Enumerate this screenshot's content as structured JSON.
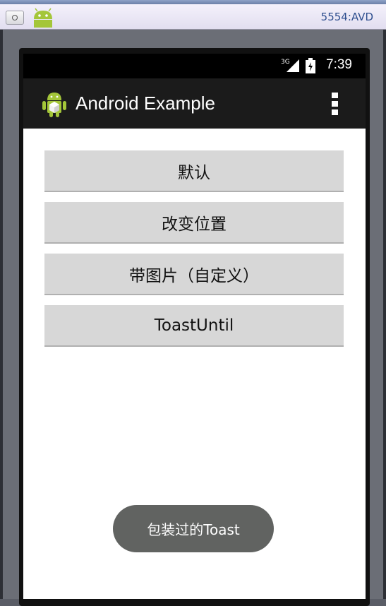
{
  "window": {
    "title": "5554:AVD",
    "android_icon": "android-robot-icon",
    "menu_icon": "window-menu-icon"
  },
  "status_bar": {
    "network_label": "3G",
    "time": "7:39",
    "signal_icon": "signal-icon",
    "battery_icon": "battery-icon"
  },
  "action_bar": {
    "title": "Android Example",
    "app_icon": "android-app-icon",
    "overflow_icon": "overflow-menu-icon",
    "background": "#1b1b1b"
  },
  "buttons": [
    {
      "label": "默认"
    },
    {
      "label": "改变位置"
    },
    {
      "label": "带图片（自定义）"
    },
    {
      "label": "ToastUntil"
    }
  ],
  "toast": {
    "message": "包装过的Toast",
    "background": "#616361"
  },
  "colors": {
    "button_bg": "#d7d7d7",
    "content_bg": "#ffffff",
    "android_green": "#a4c639",
    "title_text": "#2f4f8f"
  }
}
